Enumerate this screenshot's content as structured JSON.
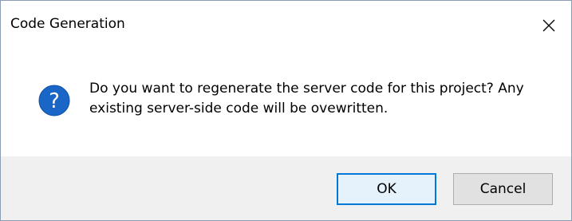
{
  "window": {
    "title": "Code Generation",
    "close_icon": "close-icon"
  },
  "message": {
    "icon": "question-icon",
    "text": "Do you want to regenerate the server code for this project? Any existing server-side code will be ovewritten."
  },
  "buttons": {
    "ok_label": "OK",
    "cancel_label": "Cancel"
  },
  "colors": {
    "icon_blue": "#1a66c7",
    "default_button_border": "#0078d7",
    "footer_background": "#f0f0f0"
  }
}
